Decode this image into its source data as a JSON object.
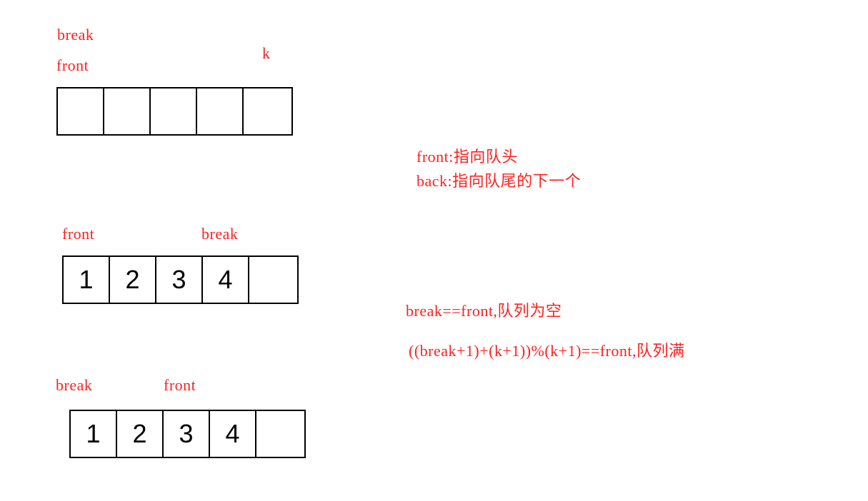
{
  "diagram1": {
    "labels": {
      "break": "break",
      "front": "front",
      "k": "k"
    },
    "cells": [
      "",
      "",
      "",
      "",
      ""
    ]
  },
  "diagram2": {
    "labels": {
      "front": "front",
      "break": "break"
    },
    "cells": [
      "1",
      "2",
      "3",
      "4",
      ""
    ]
  },
  "diagram3": {
    "labels": {
      "break": "break",
      "front": "front"
    },
    "cells": [
      "1",
      "2",
      "3",
      "4",
      ""
    ]
  },
  "notes": {
    "front_def": "front:指向队头",
    "back_def": "back:指向队尾的下一个",
    "empty_cond": "break==front,队列为空",
    "full_cond": "((break+1)+(k+1))%(k+1)==front,队列满"
  },
  "colors": {
    "annotation": "#ff2020",
    "outline": "#000000"
  }
}
